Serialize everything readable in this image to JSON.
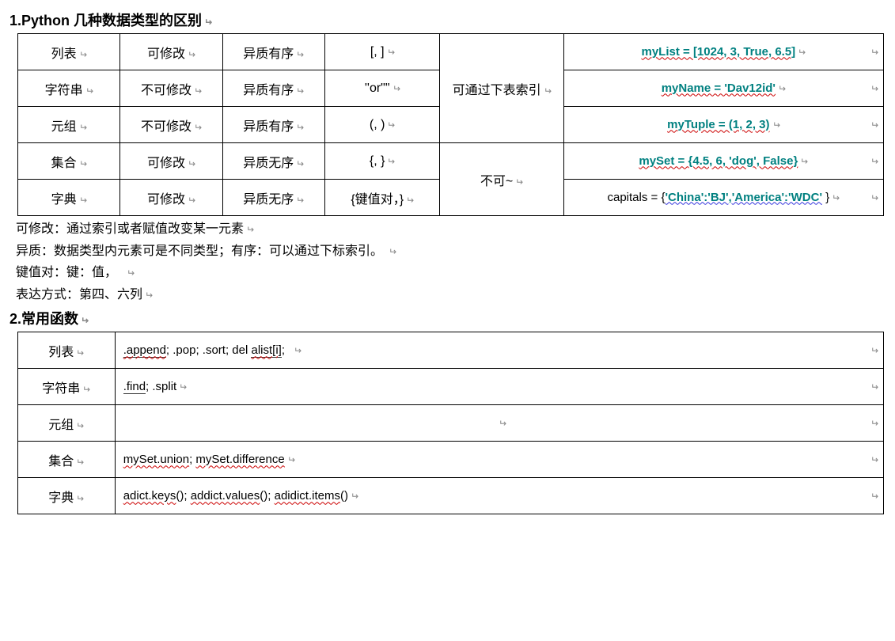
{
  "section1": {
    "heading": "1.Python 几种数据类型的区别",
    "table": {
      "rows": [
        {
          "name": "列表",
          "mutable": "可修改",
          "ordered": "异质有序",
          "syntax": "[, ]",
          "index": "可通过下表索引",
          "example": "myList = [1024, 3, True, 6.5]"
        },
        {
          "name": "字符串",
          "mutable": "不可修改",
          "ordered": "异质有序",
          "syntax": "''or\"\"",
          "index": "",
          "example": "myName = 'Dav12id'"
        },
        {
          "name": "元组",
          "mutable": "不可修改",
          "ordered": "异质有序",
          "syntax": "(, )",
          "index": "",
          "example": "myTuple = (1, 2, 3)"
        },
        {
          "name": "集合",
          "mutable": "可修改",
          "ordered": "异质无序",
          "syntax": "{, }",
          "index": "不可~",
          "example": "mySet = {4.5, 6, 'dog', False}"
        },
        {
          "name": "字典",
          "mutable": "可修改",
          "ordered": "异质无序",
          "syntax": "{键值对，}",
          "index": "",
          "example_prefix": "capitals = {",
          "example_mid": "'China':'BJ','America':'WDC'",
          "example_suffix": " }"
        }
      ]
    },
    "notes": [
      "可修改：通过索引或者赋值改变某一元素",
      "异质：数据类型内元素可是不同类型；有序：可以通过下标索引。",
      "键值对：键：值，",
      "表达方式：第四、六列"
    ]
  },
  "section2": {
    "heading": "2.常用函数",
    "table": {
      "rows": [
        {
          "name": "列表",
          "funcs_parts": [
            ".append",
            "; .pop; .sort; del ",
            "alist[i]",
            ";"
          ]
        },
        {
          "name": "字符串",
          "funcs_parts": [
            ".find",
            "; .split"
          ]
        },
        {
          "name": "元组",
          "funcs_parts": [
            ""
          ]
        },
        {
          "name": "集合",
          "funcs_parts": [
            "mySet.union",
            "; ",
            "mySet.difference"
          ]
        },
        {
          "name": "字典",
          "funcs_parts": [
            "adict.keys",
            "(); ",
            "addict.values",
            "(); ",
            "adidict.items",
            "()"
          ]
        }
      ]
    }
  },
  "glyphs": {
    "enter": "↵"
  }
}
